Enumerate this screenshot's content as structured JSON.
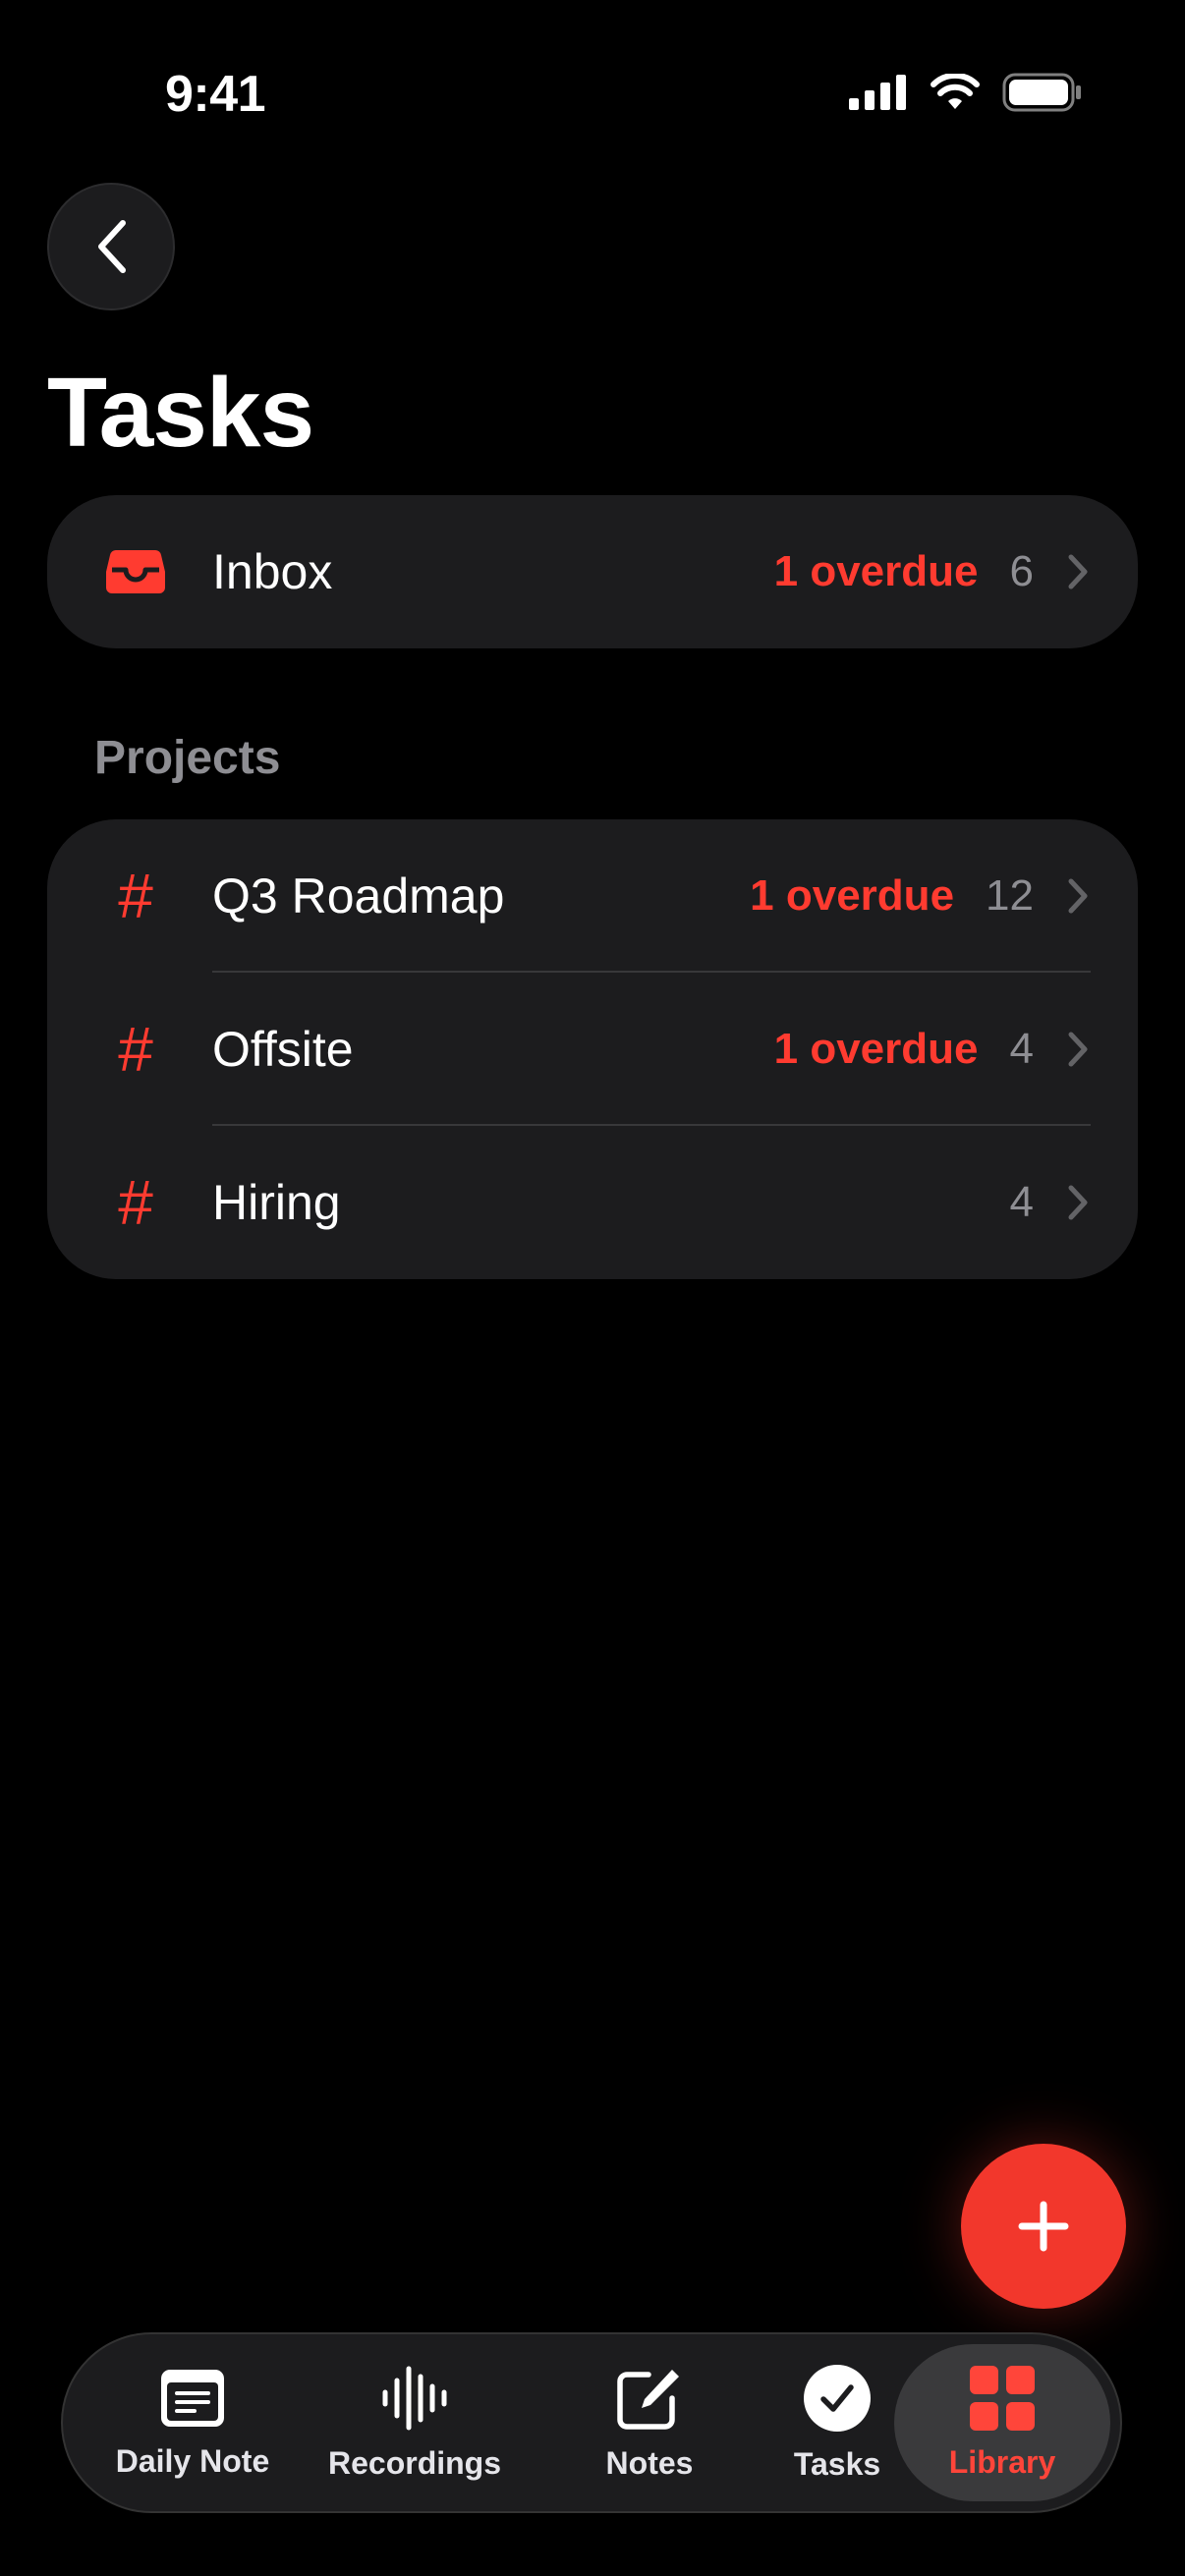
{
  "status_bar": {
    "time": "9:41"
  },
  "header": {
    "title": "Tasks"
  },
  "inbox": {
    "label": "Inbox",
    "overdue": "1 overdue",
    "count": "6"
  },
  "projects": {
    "section_title": "Projects",
    "items": [
      {
        "name": "Q3 Roadmap",
        "overdue": "1 overdue",
        "count": "12"
      },
      {
        "name": "Offsite",
        "overdue": "1 overdue",
        "count": "4"
      },
      {
        "name": "Hiring",
        "overdue": "",
        "count": "4"
      }
    ]
  },
  "tab_bar": {
    "tabs": [
      {
        "label": "Daily Note",
        "icon": "daily-note-icon"
      },
      {
        "label": "Recordings",
        "icon": "waveform-icon"
      },
      {
        "label": "Notes",
        "icon": "compose-icon"
      },
      {
        "label": "Tasks",
        "icon": "checkmark-circle-icon"
      },
      {
        "label": "Library",
        "icon": "grid-icon",
        "active": true
      }
    ]
  },
  "colors": {
    "accent": "#ff3b30",
    "card": "#1c1c1e",
    "background": "#000000",
    "secondary_text": "#8e8e93"
  }
}
